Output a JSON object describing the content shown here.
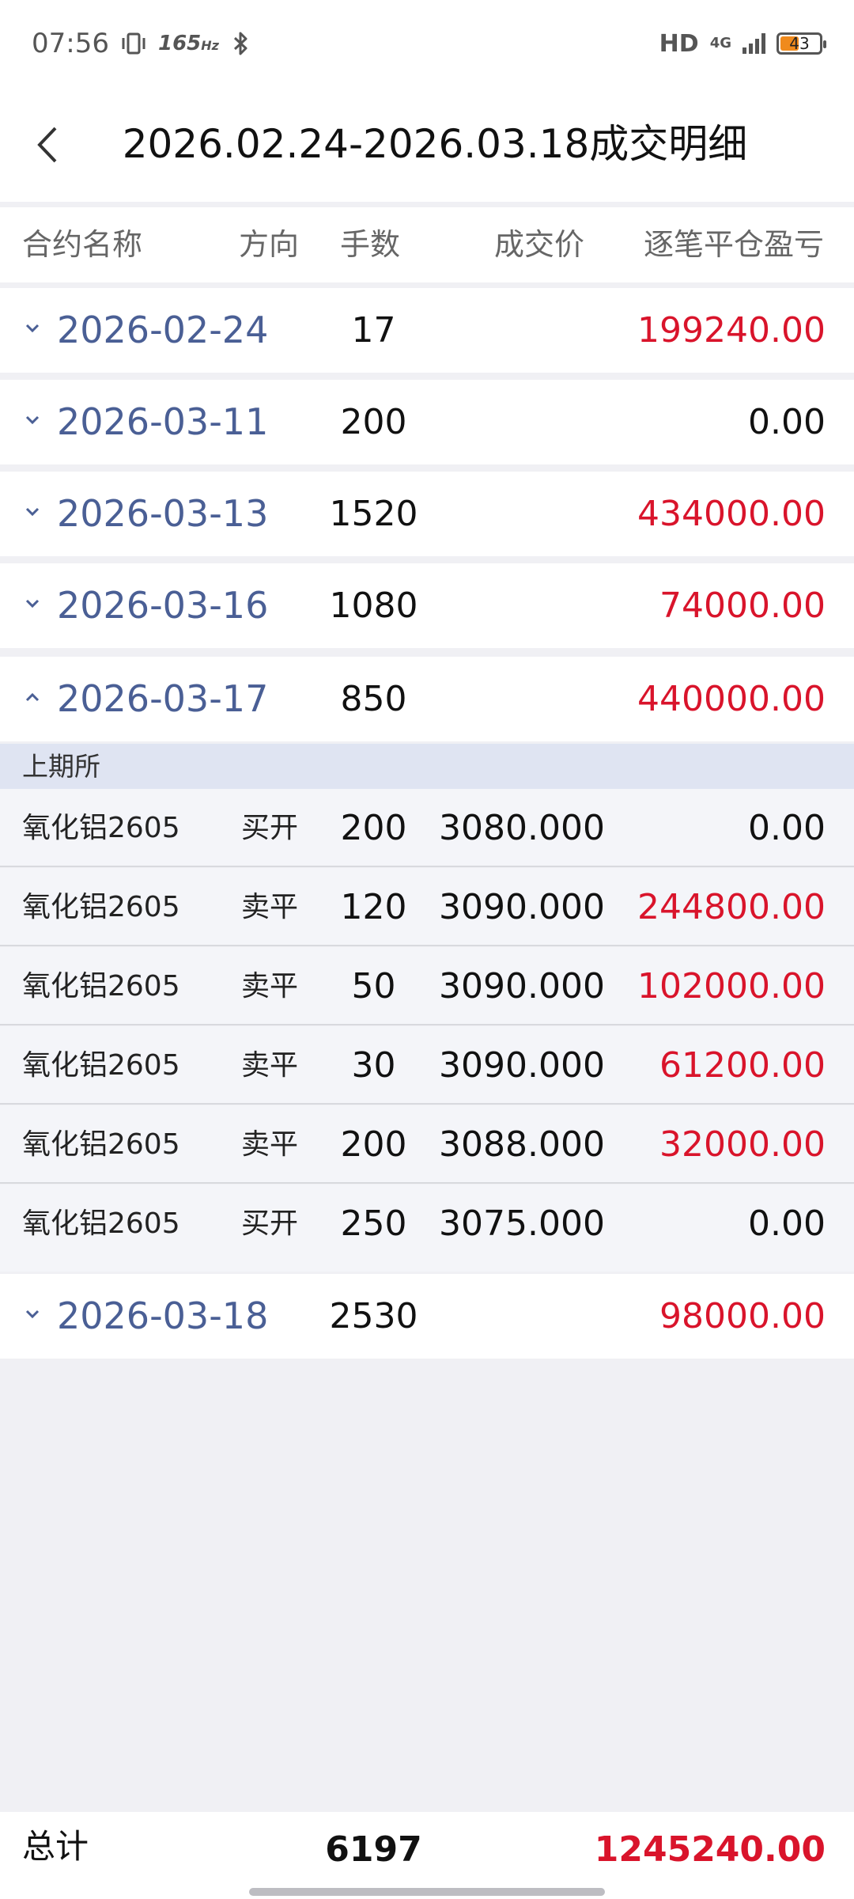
{
  "status_bar": {
    "time": "07:56",
    "refresh_rate": "165",
    "refresh_unit": "Hz",
    "network_hd": "HD",
    "network_type": "4G",
    "battery_level": "43"
  },
  "header": {
    "title": "2026.02.24-2026.03.18成交明细"
  },
  "columns": {
    "contract": "合约名称",
    "direction": "方向",
    "lots": "手数",
    "price": "成交价",
    "pnl": "逐笔平仓盈亏"
  },
  "date_groups": [
    {
      "date": "2026-02-24",
      "lots": "17",
      "pnl": "199240.00",
      "pnl_color": "red",
      "expanded": false
    },
    {
      "date": "2026-03-11",
      "lots": "200",
      "pnl": "0.00",
      "pnl_color": "black",
      "expanded": false
    },
    {
      "date": "2026-03-13",
      "lots": "1520",
      "pnl": "434000.00",
      "pnl_color": "red",
      "expanded": false
    },
    {
      "date": "2026-03-16",
      "lots": "1080",
      "pnl": "74000.00",
      "pnl_color": "red",
      "expanded": false
    },
    {
      "date": "2026-03-17",
      "lots": "850",
      "pnl": "440000.00",
      "pnl_color": "red",
      "expanded": true
    },
    {
      "date": "2026-03-18",
      "lots": "2530",
      "pnl": "98000.00",
      "pnl_color": "red",
      "expanded": false
    }
  ],
  "exchange": "上期所",
  "details": [
    {
      "contract": "氧化铝2605",
      "direction": "买开",
      "lots": "200",
      "price": "3080.000",
      "pnl": "0.00",
      "pnl_color": "black"
    },
    {
      "contract": "氧化铝2605",
      "direction": "卖平",
      "lots": "120",
      "price": "3090.000",
      "pnl": "244800.00",
      "pnl_color": "red"
    },
    {
      "contract": "氧化铝2605",
      "direction": "卖平",
      "lots": "50",
      "price": "3090.000",
      "pnl": "102000.00",
      "pnl_color": "red"
    },
    {
      "contract": "氧化铝2605",
      "direction": "卖平",
      "lots": "30",
      "price": "3090.000",
      "pnl": "61200.00",
      "pnl_color": "red"
    },
    {
      "contract": "氧化铝2605",
      "direction": "卖平",
      "lots": "200",
      "price": "3088.000",
      "pnl": "32000.00",
      "pnl_color": "red"
    },
    {
      "contract": "氧化铝2605",
      "direction": "买开",
      "lots": "250",
      "price": "3075.000",
      "pnl": "0.00",
      "pnl_color": "black"
    }
  ],
  "footer": {
    "label": "总计",
    "total_lots": "6197",
    "total_pnl": "1245240.00",
    "total_pnl_color": "red"
  },
  "colors": {
    "profit": "#d9142b",
    "date_link": "#4a5f95",
    "exchange_bg": "#dfe4f2",
    "detail_bg": "#f4f5f9",
    "page_bg": "#f0f0f4"
  }
}
